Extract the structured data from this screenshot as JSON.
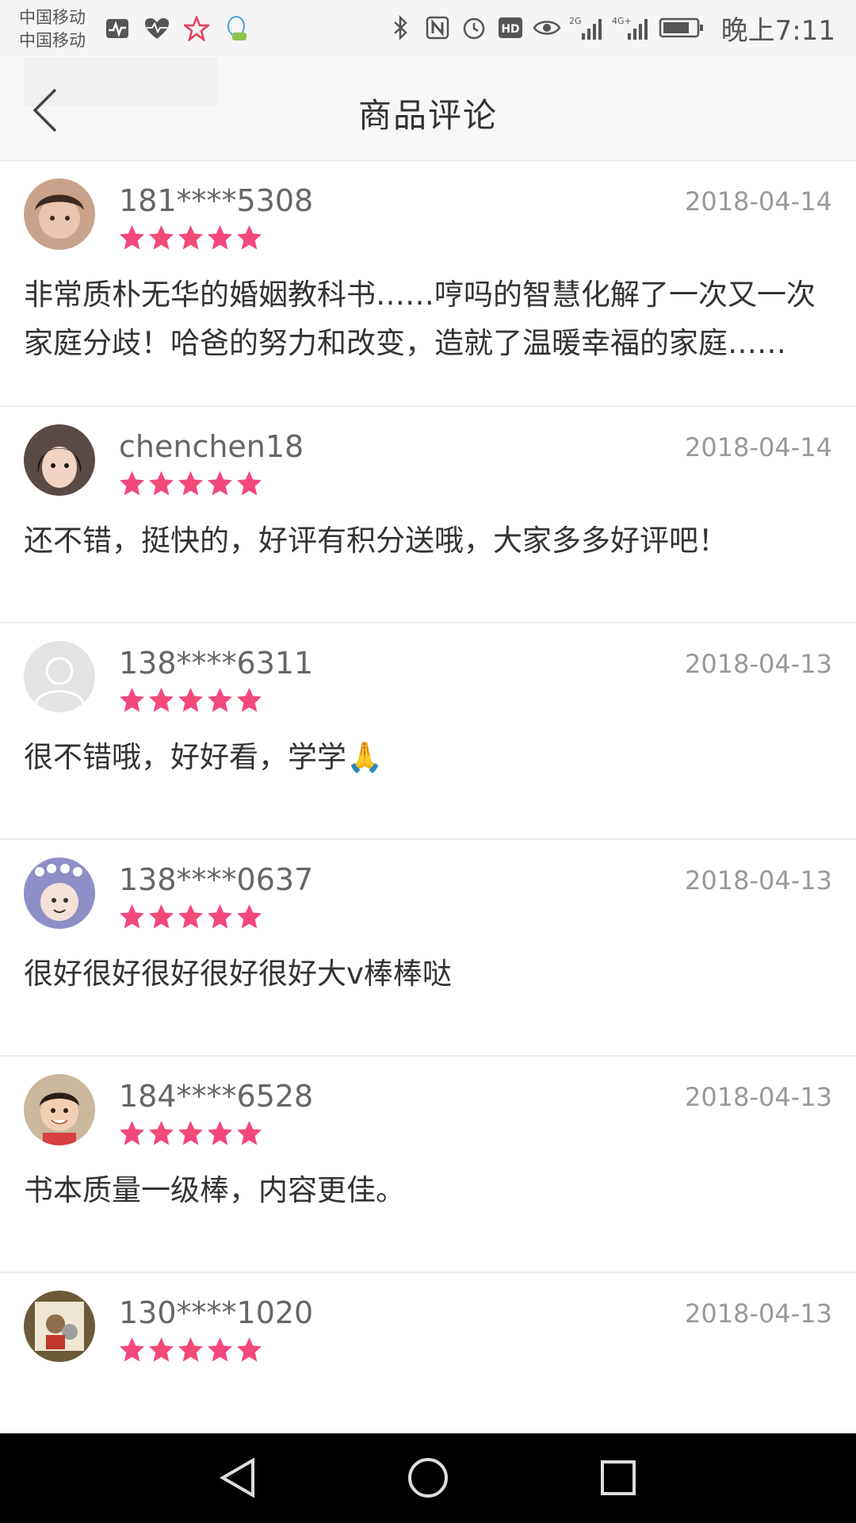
{
  "status_bar": {
    "carrier_1": "中国移动",
    "carrier_2": "中国移动",
    "signal_1": "2G",
    "signal_2": "4G+",
    "hd_label": "HD",
    "time": "晚上7:11"
  },
  "header": {
    "title": "商品评论"
  },
  "reviews": [
    {
      "user": "181****5308",
      "date": "2018-04-14",
      "rating": 5,
      "content": "非常质朴无华的婚姻教科书……哼吗的智慧化解了一次又一次家庭分歧！哈爸的努力和改变，造就了温暖幸福的家庭……",
      "avatar_color": "#c9a28c"
    },
    {
      "user": "chenchen18",
      "date": "2018-04-14",
      "rating": 5,
      "content": "还不错，挺快的，好评有积分送哦，大家多多好评吧！",
      "avatar_color": "#5a4a45"
    },
    {
      "user": "138****6311",
      "date": "2018-04-13",
      "rating": 5,
      "content": "很不错哦，好好看，学学🙏",
      "avatar_color": "#e3e3e3"
    },
    {
      "user": "138****0637",
      "date": "2018-04-13",
      "rating": 5,
      "content": "很好很好很好很好很好大v棒棒哒",
      "avatar_color": "#8f8fc8"
    },
    {
      "user": "184****6528",
      "date": "2018-04-13",
      "rating": 5,
      "content": "书本质量一级棒，内容更佳。",
      "avatar_color": "#c9b79e"
    },
    {
      "user": "130****1020",
      "date": "2018-04-13",
      "rating": 5,
      "content": "",
      "avatar_color": "#6b5a3a"
    }
  ],
  "colors": {
    "star": "#f2497a",
    "divider": "#ededed"
  }
}
